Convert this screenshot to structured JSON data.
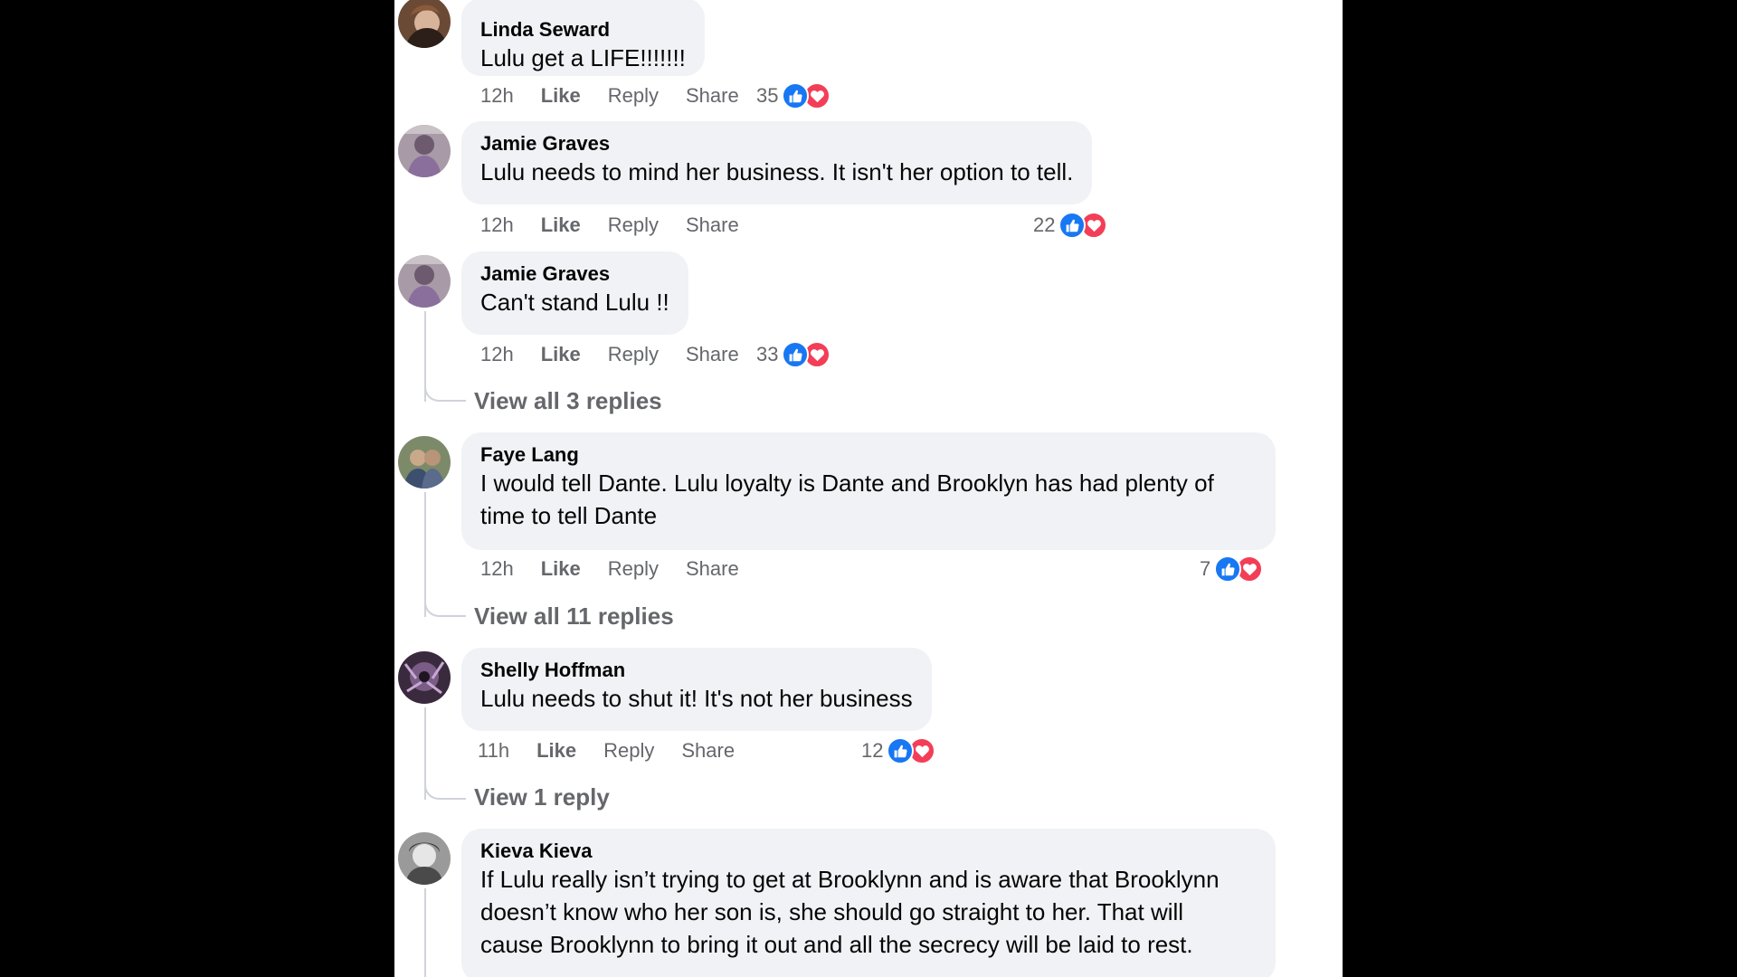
{
  "comments": [
    {
      "author": "Linda Seward",
      "text": "Lulu get a LIFE!!!!!!!",
      "time": "12h",
      "like": "Like",
      "reply": "Reply",
      "share": "Share",
      "reaction_count": "35",
      "reactions": [
        "like-icon",
        "love-icon"
      ]
    },
    {
      "author": "Jamie Graves",
      "text": "Lulu needs to mind her business. It isn't her option to tell.",
      "time": "12h",
      "like": "Like",
      "reply": "Reply",
      "share": "Share",
      "reaction_count": "22",
      "reactions": [
        "like-icon",
        "love-icon"
      ]
    },
    {
      "author": "Jamie Graves",
      "text": "Can't stand Lulu !!",
      "time": "12h",
      "like": "Like",
      "reply": "Reply",
      "share": "Share",
      "reaction_count": "33",
      "reactions": [
        "like-icon",
        "love-icon"
      ],
      "view_replies": "View all 3 replies"
    },
    {
      "author": "Faye Lang",
      "text": "I would tell Dante. Lulu loyalty is Dante and Brooklyn has had plenty of\ntime to tell Dante",
      "time": "12h",
      "like": "Like",
      "reply": "Reply",
      "share": "Share",
      "reaction_count": "7",
      "reactions": [
        "like-icon",
        "love-icon"
      ],
      "view_replies": "View all 11 replies"
    },
    {
      "author": "Shelly Hoffman",
      "text": "Lulu needs to shut it! It's not her business",
      "time": "11h",
      "like": "Like",
      "reply": "Reply",
      "share": "Share",
      "reaction_count": "12",
      "reactions": [
        "like-icon",
        "love-icon"
      ],
      "view_replies": "View 1 reply"
    },
    {
      "author": "Kieva Kieva",
      "text": "If Lulu really isn’t trying to get at Brooklynn and is aware that Brooklynn\ndoesn’t know who her son is, she should go straight to her. That will\ncause Brooklynn to bring it out and all the secrecy will be laid to rest."
    }
  ],
  "colors": {
    "page_background": "#000000",
    "panel_background": "#ffffff",
    "bubble": "#f0f2f5",
    "text": "#050505",
    "secondary_text": "#65676b",
    "like_blue": "#1877f2",
    "love_red": "#f33e58"
  }
}
